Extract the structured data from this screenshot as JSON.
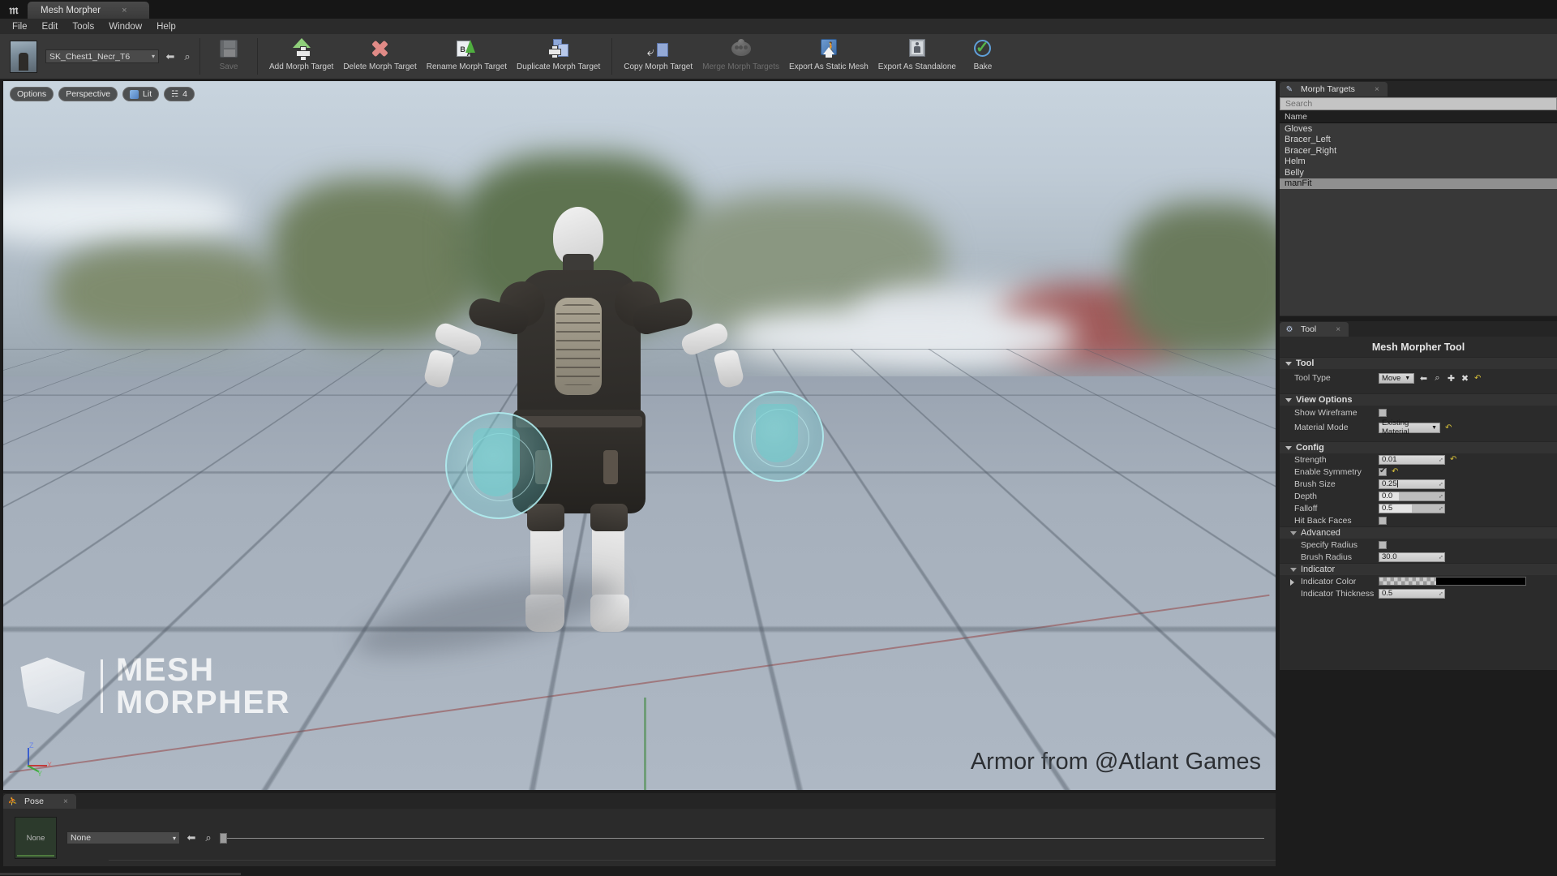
{
  "window": {
    "app_logo": "unreal-engine-logo",
    "tab_title": "Mesh Morpher",
    "tab_close": "×"
  },
  "menubar": {
    "items": [
      {
        "label": "File"
      },
      {
        "label": "Edit"
      },
      {
        "label": "Tools"
      },
      {
        "label": "Window"
      },
      {
        "label": "Help"
      }
    ]
  },
  "toolbar": {
    "asset_name": "SK_Chest1_Necr_T6",
    "asset_caret": "▾",
    "browse_icon": "⬅",
    "find_icon": "⌕",
    "buttons": [
      {
        "label": "Save",
        "icon": "save-icon",
        "disabled": true
      },
      {
        "label": "Add Morph Target",
        "icon": "add-morph-target-icon",
        "disabled": false
      },
      {
        "label": "Delete Morph Target",
        "icon": "delete-morph-target-icon",
        "disabled": false
      },
      {
        "label": "Rename Morph Target",
        "icon": "rename-morph-target-icon",
        "disabled": false
      },
      {
        "label": "Duplicate Morph Target",
        "icon": "duplicate-morph-target-icon",
        "disabled": false
      },
      {
        "label": "Copy Morph Target",
        "icon": "copy-morph-target-icon",
        "disabled": false
      },
      {
        "label": "Merge Morph Targets",
        "icon": "merge-morph-targets-icon",
        "disabled": true
      },
      {
        "label": "Export As Static Mesh",
        "icon": "export-static-mesh-icon",
        "disabled": false
      },
      {
        "label": "Export As Standalone",
        "icon": "export-standalone-icon",
        "disabled": false
      },
      {
        "label": "Bake",
        "icon": "bake-icon",
        "disabled": false
      }
    ]
  },
  "viewport": {
    "chips": [
      {
        "label": "Options",
        "icon": null
      },
      {
        "label": "Perspective",
        "icon": null
      },
      {
        "label": "Lit",
        "icon": "cube-icon"
      },
      {
        "label": "4",
        "icon": "lighting-icon"
      }
    ],
    "watermark_line1": "MESH",
    "watermark_line2": "MORPHER",
    "credit": "Armor from @Atlant Games",
    "gizmo": {
      "z": "Z",
      "x": "X",
      "y": "Y"
    }
  },
  "morph_targets_panel": {
    "tab_label": "Morph Targets",
    "tab_close": "×",
    "search_placeholder": "Search",
    "column_header": "Name",
    "items": [
      {
        "name": "Gloves",
        "selected": false
      },
      {
        "name": "Bracer_Left",
        "selected": false
      },
      {
        "name": "Bracer_Right",
        "selected": false
      },
      {
        "name": "Helm",
        "selected": false
      },
      {
        "name": "Belly",
        "selected": false
      },
      {
        "name": "manFit",
        "selected": true
      }
    ]
  },
  "tool_panel": {
    "tab_label": "Tool",
    "tab_close": "×",
    "title": "Mesh Morpher Tool",
    "sections": {
      "tool": {
        "header": "Tool",
        "tool_type_label": "Tool Type",
        "tool_type_value": "Move",
        "actions": [
          "browse-icon",
          "find-icon",
          "add-icon",
          "delete-icon",
          "revert-icon"
        ]
      },
      "view_options": {
        "header": "View Options",
        "show_wireframe_label": "Show Wireframe",
        "show_wireframe_checked": false,
        "material_mode_label": "Material Mode",
        "material_mode_value": "Existing Material"
      },
      "config": {
        "header": "Config",
        "strength_label": "Strength",
        "strength_value": "0.01",
        "enable_symmetry_label": "Enable Symmetry",
        "enable_symmetry_checked": true,
        "brush_size_label": "Brush Size",
        "brush_size_value": "0.25",
        "depth_label": "Depth",
        "depth_value": "0.0",
        "falloff_label": "Falloff",
        "falloff_value": "0.5",
        "hit_back_faces_label": "Hit Back Faces",
        "hit_back_faces_checked": false
      },
      "advanced": {
        "header": "Advanced",
        "specify_radius_label": "Specify Radius",
        "specify_radius_checked": false,
        "brush_radius_label": "Brush Radius",
        "brush_radius_value": "30.0"
      },
      "indicator": {
        "header": "Indicator",
        "indicator_color_label": "Indicator Color",
        "indicator_color_value": "#000000",
        "indicator_thickness_label": "Indicator Thickness",
        "indicator_thickness_value": "0.5"
      }
    }
  },
  "pose_panel": {
    "tab_label": "Pose",
    "tab_close": "×",
    "thumb_label": "None",
    "combo_value": "None",
    "combo_caret": "▾",
    "browse_icon": "⬅",
    "find_icon": "⌕"
  },
  "colors": {
    "accent_yellow": "#d8c13a",
    "selection_gray": "#8f8f8f",
    "brush_cyan": "#6fd0d4",
    "panel_bg": "#2b2b2b"
  }
}
